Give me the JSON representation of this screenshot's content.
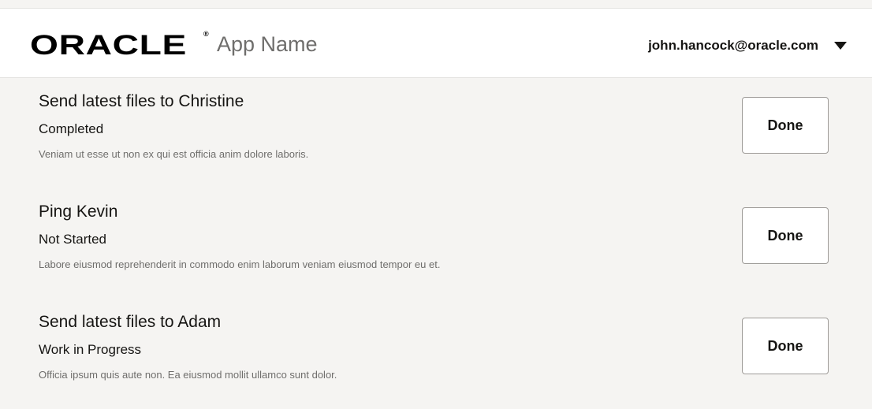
{
  "header": {
    "logo_text": "ORACLE",
    "logo_reg": "®",
    "app_name": "App Name",
    "user_email": "john.hancock@oracle.com",
    "menu_icon": "caret-down-icon"
  },
  "tasks": [
    {
      "title": "Send latest files to Christine",
      "status": "Completed",
      "description": "Veniam ut esse ut non ex qui est officia anim dolore laboris.",
      "button_label": "Done"
    },
    {
      "title": "Ping Kevin",
      "status": "Not Started",
      "description": "Labore eiusmod reprehenderit in commodo enim laborum veniam eiusmod tempor eu et.",
      "button_label": "Done"
    },
    {
      "title": "Send latest files to Adam",
      "status": "Work in Progress",
      "description": "Officia ipsum quis aute non. Ea eiusmod mollit ullamco sunt dolor.",
      "button_label": "Done"
    }
  ],
  "colors": {
    "background": "#f5f4f2",
    "header_bg": "#ffffff",
    "text_primary": "#161513",
    "text_secondary": "#6f6e6c",
    "button_border": "#9e9b98"
  }
}
